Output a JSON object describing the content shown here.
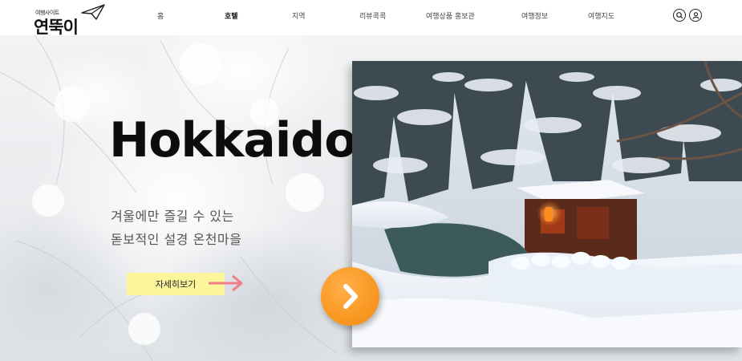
{
  "logo": {
    "tagline": "여행사이트",
    "name": "연뚝이",
    "icon": "paper-plane-icon"
  },
  "nav": {
    "items": [
      {
        "label": "홈",
        "active": false
      },
      {
        "label": "호텔",
        "active": true
      },
      {
        "label": "지역",
        "active": false
      },
      {
        "label": "리뷰콕콕",
        "active": false
      },
      {
        "label": "여행상품 홍보관",
        "active": false
      },
      {
        "label": "여행정보",
        "active": false
      },
      {
        "label": "여행지도",
        "active": false
      }
    ],
    "search_icon": "search-icon",
    "user_icon": "user-icon"
  },
  "hero": {
    "title": "Hokkaido :",
    "line1": "겨울에만 즐길 수 있는",
    "line2": "돋보적인 설경 온천마을",
    "detail_button": "자세히보기",
    "arrow_icon": "right-arrow-icon",
    "next_icon": "chevron-right-icon"
  },
  "colors": {
    "accent_orange": "#fa9a25",
    "button_yellow": "#fbf59b",
    "arrow_pink": "#ef7f86"
  }
}
